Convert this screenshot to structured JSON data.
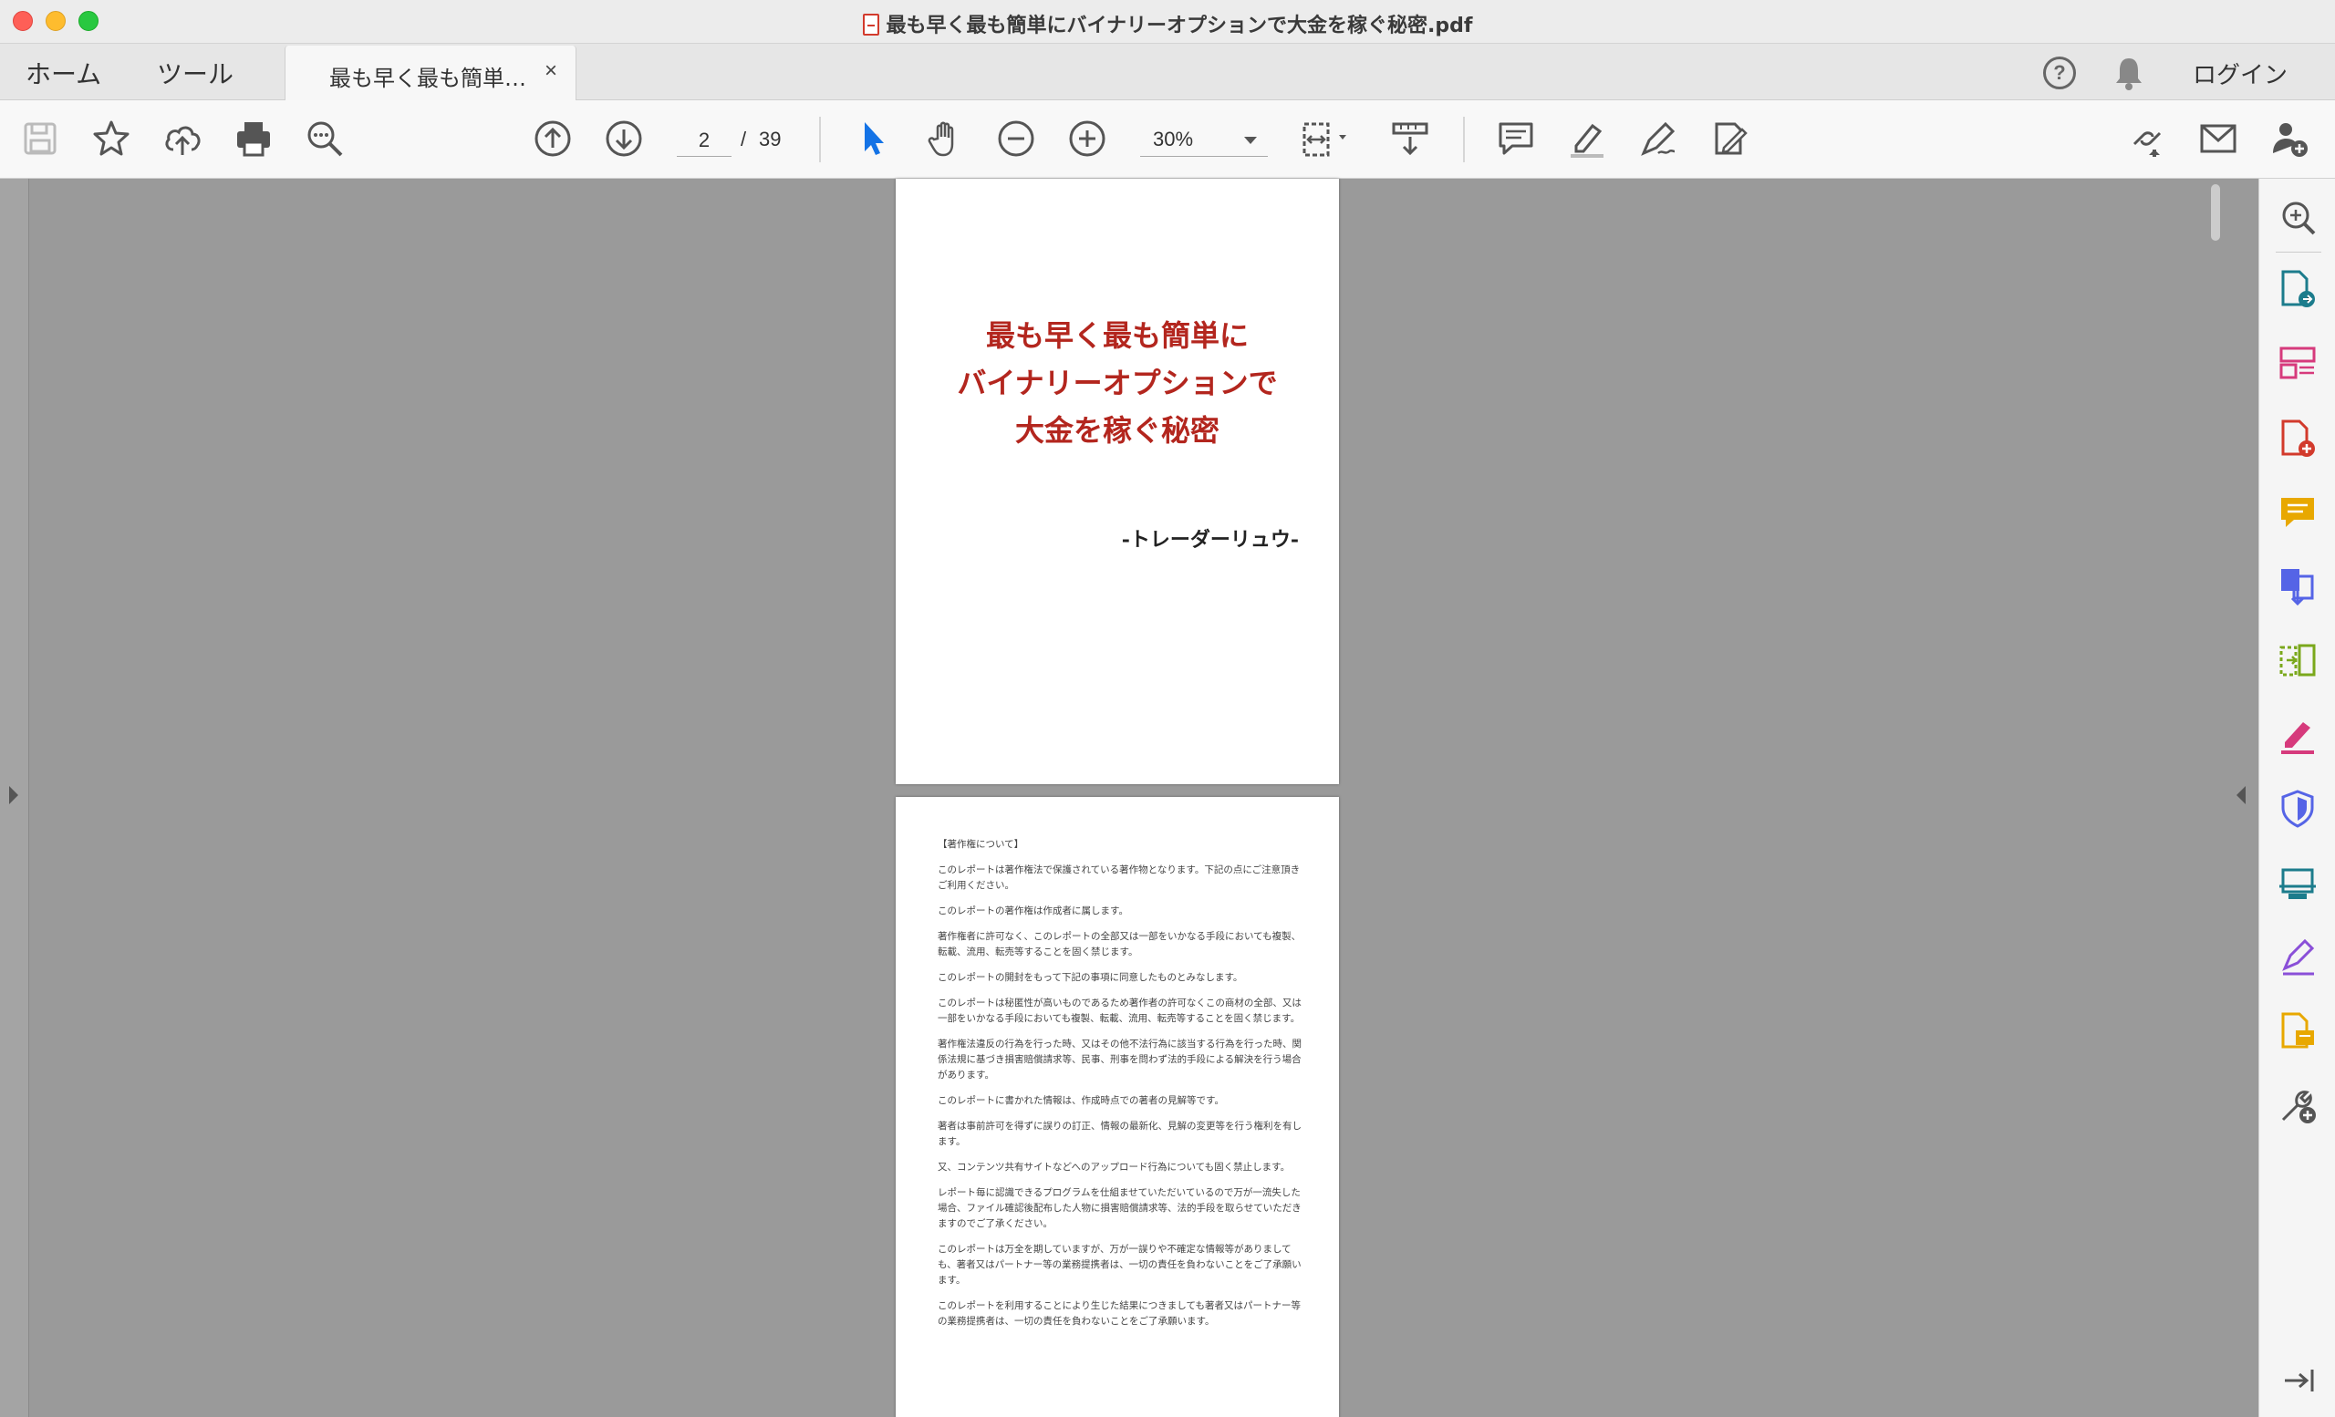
{
  "window": {
    "title": "最も早く最も簡単にバイナリーオプションで大金を稼ぐ秘密.pdf"
  },
  "tabs": {
    "home": "ホーム",
    "tools": "ツール",
    "document_tab": "最も早く最も簡単…",
    "close": "×",
    "help": "?",
    "login": "ログイン"
  },
  "toolbar": {
    "page_current": "2",
    "page_separator": "/",
    "page_total": "39",
    "zoom": "30%"
  },
  "document": {
    "cover_title_lines": [
      "最も早く最も簡単に",
      "バイナリーオプションで",
      "大金を稼ぐ秘密"
    ],
    "cover_author": "-トレーダーリュウ-",
    "page2_paragraphs": [
      "【著作権について】",
      "このレポートは著作権法で保護されている著作物となります。下記の点にご注意頂きご利用ください。",
      "このレポートの著作権は作成者に属します。",
      "著作権者に許可なく、このレポートの全部又は一部をいかなる手段においても複製、転載、流用、転売等することを固く禁じます。",
      "このレポートの開封をもって下記の事項に同意したものとみなします。",
      "このレポートは秘匿性が高いものであるため著作者の許可なくこの商材の全部、又は一部をいかなる手段においても複製、転載、流用、転売等することを固く禁じます。",
      "著作権法違反の行為を行った時、又はその他不法行為に該当する行為を行った時、関係法規に基づき損害賠償請求等、民事、刑事を問わず法的手段による解決を行う場合があります。",
      "このレポートに書かれた情報は、作成時点での著者の見解等です。",
      "著者は事前許可を得ずに誤りの訂正、情報の最新化、見解の変更等を行う権利を有します。",
      "又、コンテンツ共有サイトなどへのアップロード行為についても固く禁止します。",
      "レポート毎に認識できるプログラムを仕組ませていただいているので万が一流失した場合、ファイル確認後配布した人物に損害賠償請求等、法的手段を取らせていただきますのでご了承ください。",
      "このレポートは万全を期していますが、万が一誤りや不確定な情報等がありましても、著者又はパートナー等の業務提携者は、一切の責任を負わないことをご了承願います。",
      "このレポートを利用することにより生じた結果につきましても著者又はパートナー等の業務提携者は、一切の責任を負わないことをご了承願います。"
    ]
  },
  "colors": {
    "accent_blue": "#1473e6",
    "cover_title_red": "#b3261e"
  }
}
